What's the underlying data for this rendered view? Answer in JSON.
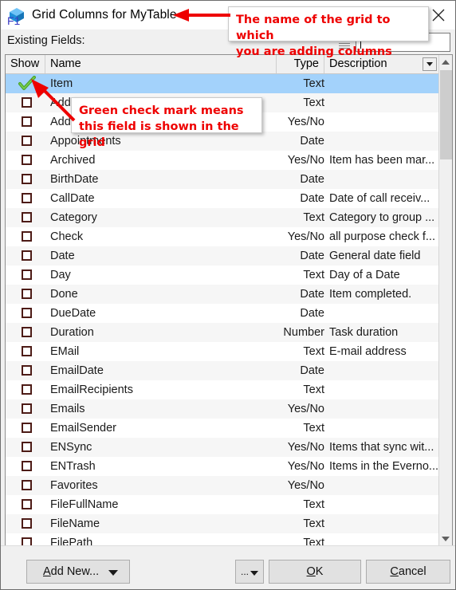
{
  "window": {
    "title": "Grid Columns for MyTable",
    "icon": "cube-icon",
    "close_label": "Close"
  },
  "toolbar": {
    "existing_fields_label": "Existing Fields:",
    "filter_value": "",
    "filter_placeholder": "",
    "grip_icon": "grip-handle-icon"
  },
  "grid": {
    "columns": [
      "Show",
      "Name",
      "Type",
      "Description"
    ],
    "header_dropdown_icon": "chevron-down-icon",
    "rows": [
      {
        "show": true,
        "name": "Item",
        "type": "Text",
        "desc": ""
      },
      {
        "show": false,
        "name": "Add",
        "type": "Text",
        "desc": ""
      },
      {
        "show": false,
        "name": "Add",
        "type": "Yes/No",
        "desc": ""
      },
      {
        "show": false,
        "name": "Appointments",
        "type": "Date",
        "desc": ""
      },
      {
        "show": false,
        "name": "Archived",
        "type": "Yes/No",
        "desc": "Item has been mar..."
      },
      {
        "show": false,
        "name": "BirthDate",
        "type": "Date",
        "desc": ""
      },
      {
        "show": false,
        "name": "CallDate",
        "type": "Date",
        "desc": "Date of call receiv..."
      },
      {
        "show": false,
        "name": "Category",
        "type": "Text",
        "desc": "Category to group ..."
      },
      {
        "show": false,
        "name": "Check",
        "type": "Yes/No",
        "desc": "all purpose check f..."
      },
      {
        "show": false,
        "name": "Date",
        "type": "Date",
        "desc": "General date field"
      },
      {
        "show": false,
        "name": "Day",
        "type": "Text",
        "desc": "Day of a Date"
      },
      {
        "show": false,
        "name": "Done",
        "type": "Date",
        "desc": "Item completed."
      },
      {
        "show": false,
        "name": "DueDate",
        "type": "Date",
        "desc": ""
      },
      {
        "show": false,
        "name": "Duration",
        "type": "Number",
        "desc": "Task duration"
      },
      {
        "show": false,
        "name": "EMail",
        "type": "Text",
        "desc": "E-mail address"
      },
      {
        "show": false,
        "name": "EmailDate",
        "type": "Date",
        "desc": ""
      },
      {
        "show": false,
        "name": "EmailRecipients",
        "type": "Text",
        "desc": ""
      },
      {
        "show": false,
        "name": "Emails",
        "type": "Yes/No",
        "desc": ""
      },
      {
        "show": false,
        "name": "EmailSender",
        "type": "Text",
        "desc": ""
      },
      {
        "show": false,
        "name": "ENSync",
        "type": "Yes/No",
        "desc": "Items that sync wit..."
      },
      {
        "show": false,
        "name": "ENTrash",
        "type": "Yes/No",
        "desc": "Items in the Everno..."
      },
      {
        "show": false,
        "name": "Favorites",
        "type": "Yes/No",
        "desc": ""
      },
      {
        "show": false,
        "name": "FileFullName",
        "type": "Text",
        "desc": ""
      },
      {
        "show": false,
        "name": "FileName",
        "type": "Text",
        "desc": ""
      },
      {
        "show": false,
        "name": "FilePath",
        "type": "Text",
        "desc": ""
      }
    ],
    "scrollbar": {
      "up_icon": "chevron-up-icon",
      "down_icon": "chevron-down-icon"
    }
  },
  "footer": {
    "help_key": "F1",
    "add_new_label": "Add New...",
    "add_new_dropdown_icon": "triangle-down-icon",
    "ellipsis_label": "...",
    "ellipsis_dropdown_icon": "triangle-down-icon",
    "ok_label": "OK",
    "cancel_label": "Cancel"
  },
  "annotations": {
    "accent_color": "#ee0000",
    "title_callout": "The name of the grid to which\nyou are adding columns",
    "check_callout": "Green check mark means\nthis field is shown in the grid"
  }
}
